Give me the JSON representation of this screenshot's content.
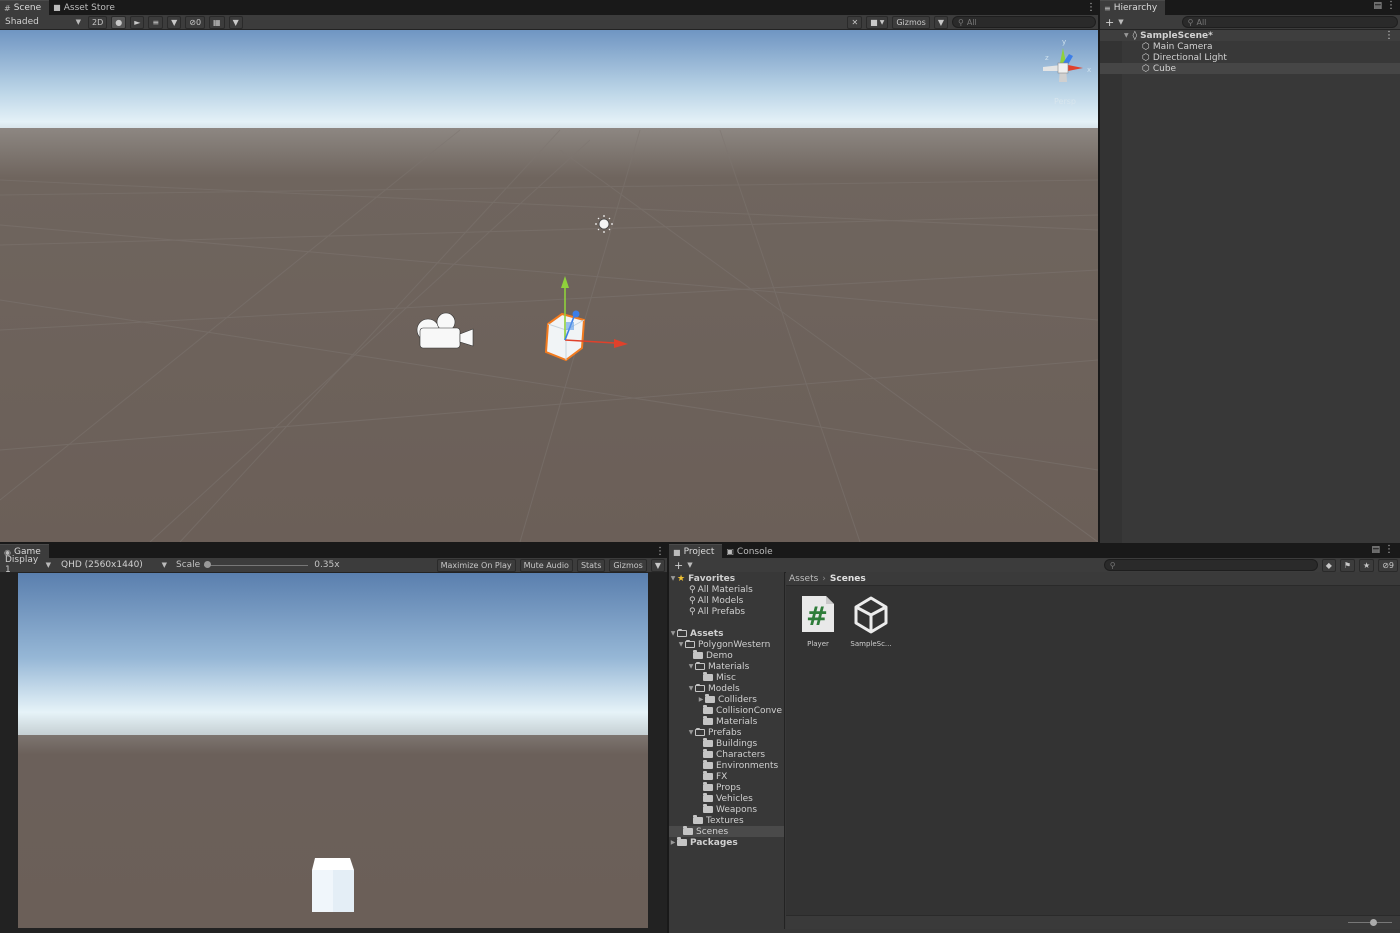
{
  "scene_panel": {
    "tabs": [
      {
        "label": "Scene",
        "icon": "grid-icon"
      },
      {
        "label": "Asset Store",
        "icon": "bag-icon"
      }
    ],
    "draw_mode": "Shaded",
    "toggle_2d": "2D",
    "hidden_count": "0",
    "gizmos_label": "Gizmos",
    "search_placeholder": "All",
    "orientation_label": "Persp",
    "axis_labels": {
      "x": "x",
      "y": "y",
      "z": "z"
    }
  },
  "hierarchy": {
    "tab_label": "Hierarchy",
    "search_placeholder": "All",
    "scene_name": "SampleScene*",
    "items": [
      {
        "label": "Main Camera"
      },
      {
        "label": "Directional Light"
      },
      {
        "label": "Cube"
      }
    ]
  },
  "game_panel": {
    "tab_label": "Game",
    "display": "Display 1",
    "resolution": "QHD (2560x1440)",
    "scale_label": "Scale",
    "scale_value": "0.35x",
    "scale_fraction": 0.0,
    "maximize_label": "Maximize On Play",
    "mute_label": "Mute Audio",
    "stats_label": "Stats",
    "gizmos_label": "Gizmos"
  },
  "project_panel": {
    "tabs": [
      {
        "label": "Project",
        "icon": "folder-icon"
      },
      {
        "label": "Console",
        "icon": "console-icon"
      }
    ],
    "hidden_count": "9",
    "breadcrumb": [
      "Assets",
      "Scenes"
    ],
    "favorites": {
      "label": "Favorites",
      "items": [
        "All Materials",
        "All Models",
        "All Prefabs"
      ]
    },
    "tree": [
      {
        "label": "Assets"
      },
      {
        "label": "PolygonWestern"
      },
      {
        "label": "Demo"
      },
      {
        "label": "Materials"
      },
      {
        "label": "Misc"
      },
      {
        "label": "Models"
      },
      {
        "label": "Colliders"
      },
      {
        "label": "CollisionConve"
      },
      {
        "label": "Materials"
      },
      {
        "label": "Prefabs"
      },
      {
        "label": "Buildings"
      },
      {
        "label": "Characters"
      },
      {
        "label": "Environments"
      },
      {
        "label": "FX"
      },
      {
        "label": "Props"
      },
      {
        "label": "Vehicles"
      },
      {
        "label": "Weapons"
      },
      {
        "label": "Textures"
      },
      {
        "label": "Scenes"
      },
      {
        "label": "Packages"
      }
    ],
    "assets": [
      {
        "label": "Player",
        "icon": "csharp-script-icon"
      },
      {
        "label": "SampleSc...",
        "icon": "unity-scene-icon"
      }
    ],
    "zoom_fraction": 0.6
  },
  "colors": {
    "panel": "#383838",
    "toolbar": "#3c3c3c",
    "sky_top": "#5a7fae",
    "horizon": "#d9ecf5",
    "ground": "#6b6059",
    "selection_outline": "#f27b1f",
    "axis_x": "#e0412b",
    "axis_y": "#8fd13b",
    "axis_z": "#3c7ee8"
  }
}
